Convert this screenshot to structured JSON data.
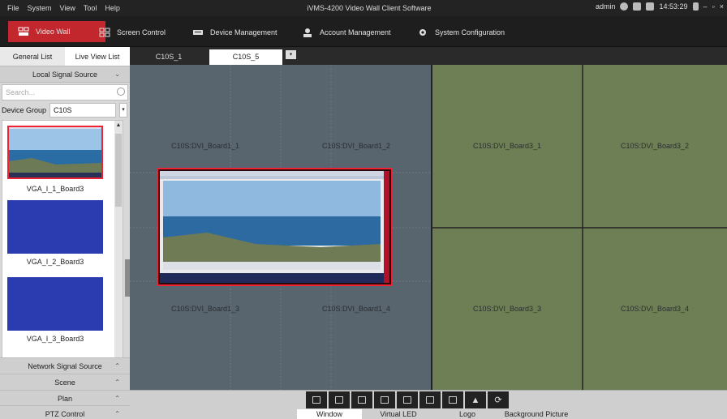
{
  "menu": [
    "File",
    "System",
    "View",
    "Tool",
    "Help"
  ],
  "app_title": "iVMS-4200 Video Wall Client Software",
  "status": {
    "user": "admin",
    "time": "14:53:29"
  },
  "nav": {
    "video_wall": "Video Wall",
    "screen_control": "Screen Control",
    "device_management": "Device Management",
    "account_management": "Account Management",
    "system_configuration": "System Configuration"
  },
  "left_tabs": {
    "general": "General List",
    "live_view": "Live View List"
  },
  "local_source": {
    "title": "Local Signal Source",
    "search_placeholder": "Search...",
    "device_group_label": "Device Group",
    "device_group_value": "C10S",
    "items": [
      {
        "label": "VGA_I_1_Board3",
        "preview": "landscape"
      },
      {
        "label": "VGA_I_2_Board3",
        "preview": "blue"
      },
      {
        "label": "VGA_I_3_Board3",
        "preview": "blue"
      }
    ]
  },
  "bottom_sections": [
    "Network Signal Source",
    "Scene",
    "Plan",
    "PTZ Control"
  ],
  "screen_tabs": [
    "C10S_1",
    "C10S_5"
  ],
  "wall_cells": {
    "c1": "C10S:DVI_Board1_1",
    "c2": "C10S:DVI_Board1_2",
    "c3": "C10S:DVI_Board3_1",
    "c4": "C10S:DVI_Board3_2",
    "c5": "C10S:DVI_Board1_3",
    "c6": "C10S:DVI_Board1_4",
    "c7": "C10S:DVI_Board3_3",
    "c8": "C10S:DVI_Board3_4"
  },
  "bottom_tabs": [
    "Window",
    "Virtual LED",
    "Logo",
    "Background Picture"
  ],
  "colors": {
    "accent": "#c1272d",
    "wall_blue": "#58646e",
    "wall_green": "#6e7f55",
    "window_border": "#e22233"
  }
}
